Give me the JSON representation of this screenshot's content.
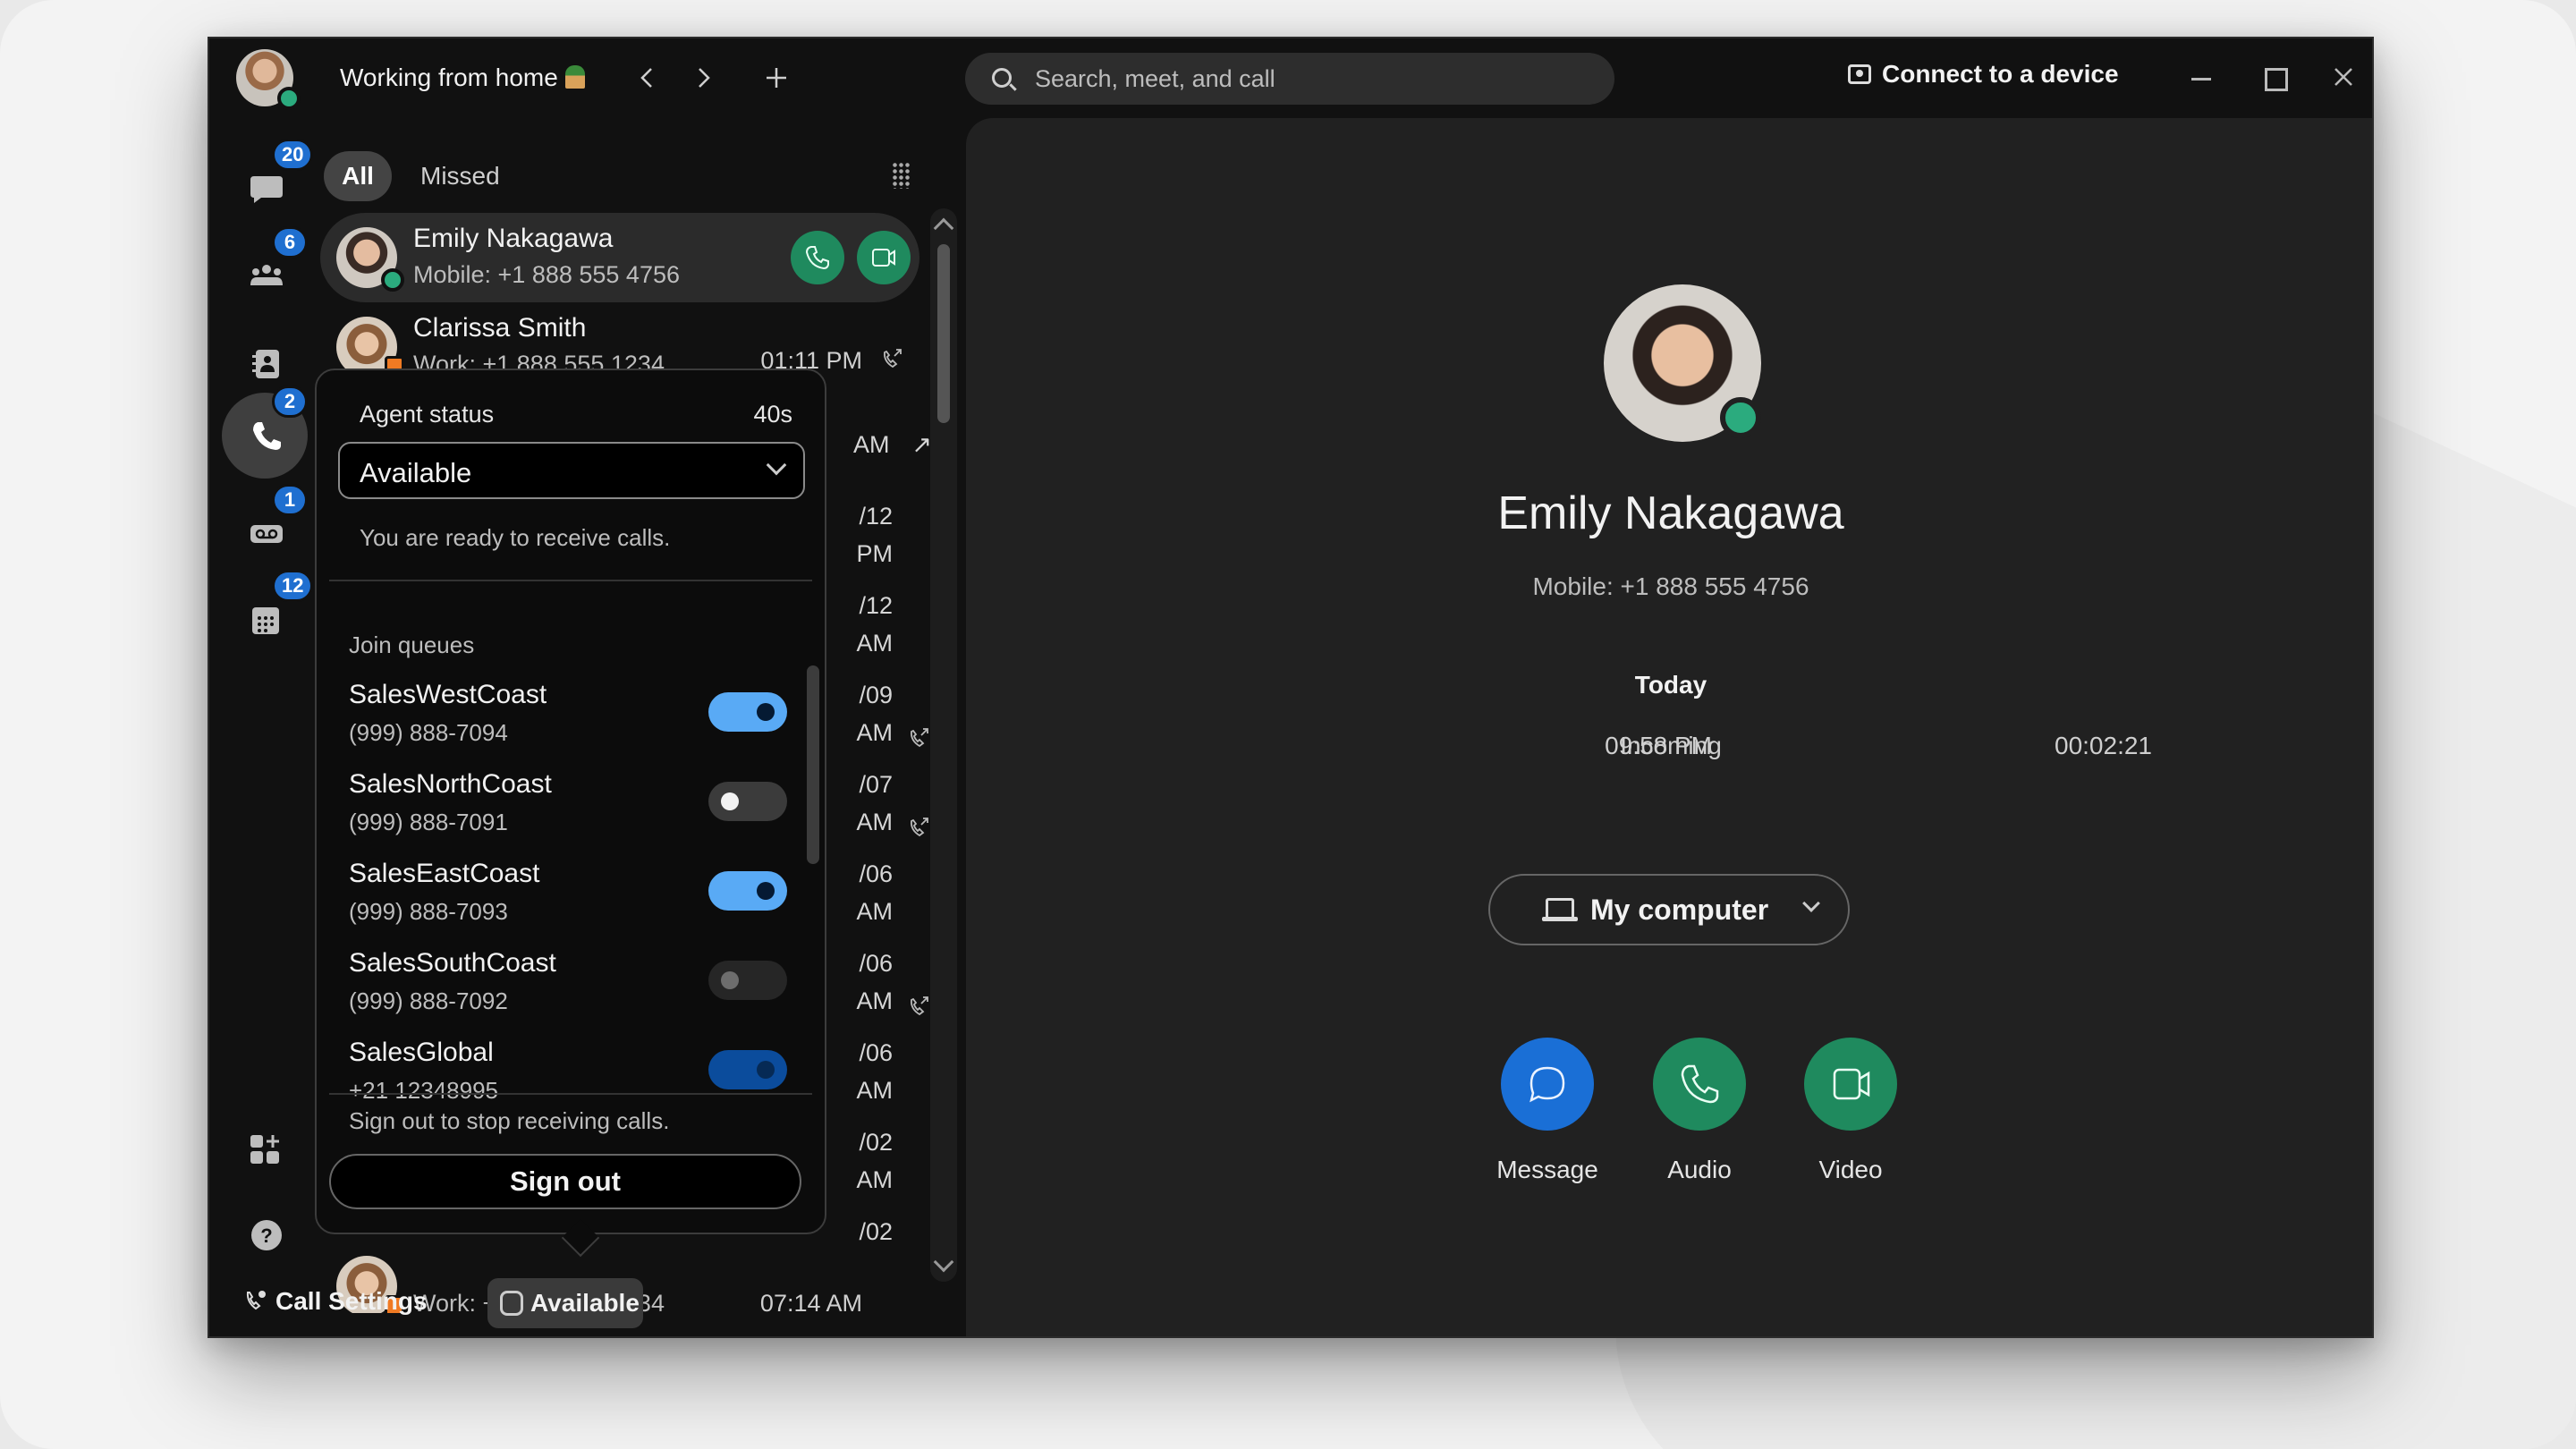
{
  "titlebar": {
    "status_text": "Working from home",
    "status_emoji": "house-with-tree",
    "back_label": "‹",
    "forward_label": "›",
    "new_label": "+",
    "search_placeholder": "Search, meet, and call",
    "connect_label": "Connect to a device"
  },
  "rail": {
    "items": [
      {
        "name": "messaging",
        "icon": "chat-bubble-icon",
        "badge": "20",
        "active": false
      },
      {
        "name": "teams",
        "icon": "people-icon",
        "badge": "6",
        "active": false
      },
      {
        "name": "contacts",
        "icon": "contacts-book-icon",
        "badge": "",
        "active": false
      },
      {
        "name": "calling",
        "icon": "phone-icon",
        "badge": "2",
        "active": true
      },
      {
        "name": "voicemail",
        "icon": "voicemail-icon",
        "badge": "1",
        "active": false
      },
      {
        "name": "meetings",
        "icon": "calendar-icon",
        "badge": "12",
        "active": false
      }
    ],
    "apps_icon": "add-apps-icon",
    "help_icon": "help-icon"
  },
  "filters": {
    "all_label": "All",
    "missed_label": "Missed"
  },
  "call_list": {
    "rows": [
      {
        "name": "Emily Nakagawa",
        "sub": "Mobile: +1 888 555 4756",
        "time": "",
        "selected": true,
        "presence": "available"
      },
      {
        "name": "Clarissa Smith",
        "sub": "Work: +1 888 555 1234",
        "time": "01:11 PM",
        "icon": "outgoing-call-icon",
        "presence": "in-meeting"
      }
    ],
    "peek_rows": [
      {
        "date": "",
        "time": "AM",
        "icon": true
      },
      {
        "date": "/12",
        "time": "PM",
        "icon": false
      },
      {
        "date": "/12",
        "time": "AM",
        "icon": true
      },
      {
        "date": "/09",
        "time": "AM",
        "icon": true
      },
      {
        "date": "/07",
        "time": "AM",
        "icon": false
      },
      {
        "date": "/06",
        "time": "AM",
        "icon": true
      },
      {
        "date": "/06",
        "time": "AM",
        "icon": false
      },
      {
        "date": "/06",
        "time": "AM",
        "icon": false
      },
      {
        "date": "/02",
        "time": "AM",
        "icon": false
      },
      {
        "date": "/02",
        "time": "",
        "icon": false
      }
    ],
    "last_row": {
      "sub": "Work: +1 888 555 1234",
      "time": "07:14 AM"
    }
  },
  "agent_popup": {
    "status_label": "Agent status",
    "timer": "40s",
    "selected_status": "Available",
    "status_hint": "You are ready to receive calls.",
    "queues_label": "Join queues",
    "queues": [
      {
        "name": "SalesWestCoast",
        "number": "(999) 888-7094",
        "state": "on"
      },
      {
        "name": "SalesNorthCoast",
        "number": "(999) 888-7091",
        "state": "off"
      },
      {
        "name": "SalesEastCoast",
        "number": "(999) 888-7093",
        "state": "on"
      },
      {
        "name": "SalesSouthCoast",
        "number": "(999) 888-7092",
        "state": "disabled"
      },
      {
        "name": "SalesGlobal",
        "number": "+21 12348995",
        "state": "locked-on"
      }
    ],
    "signout_hint": "Sign out to stop receiving calls.",
    "signout_label": "Sign out"
  },
  "bottom_bar": {
    "call_settings_label": "Call Settings",
    "agent_status_label": "Available"
  },
  "detail": {
    "name": "Emily Nakagawa",
    "sub": "Mobile: +1 888 555 4756",
    "presence": "available",
    "history_heading": "Today",
    "history": [
      {
        "time": "09:58 PM",
        "direction": "Incoming",
        "duration": "00:02:21"
      }
    ],
    "device_label": "My computer",
    "actions": [
      {
        "label": "Message",
        "color": "#1a6fd6"
      },
      {
        "label": "Audio",
        "color": "#1f8a5e"
      },
      {
        "label": "Video",
        "color": "#1f8a5e"
      }
    ]
  },
  "colors": {
    "accent_blue": "#1f6fd0",
    "call_green": "#1f8a5e",
    "presence_green": "#2bab7e",
    "toggle_on": "#59aaf5",
    "meeting_orange": "#f07a23"
  }
}
